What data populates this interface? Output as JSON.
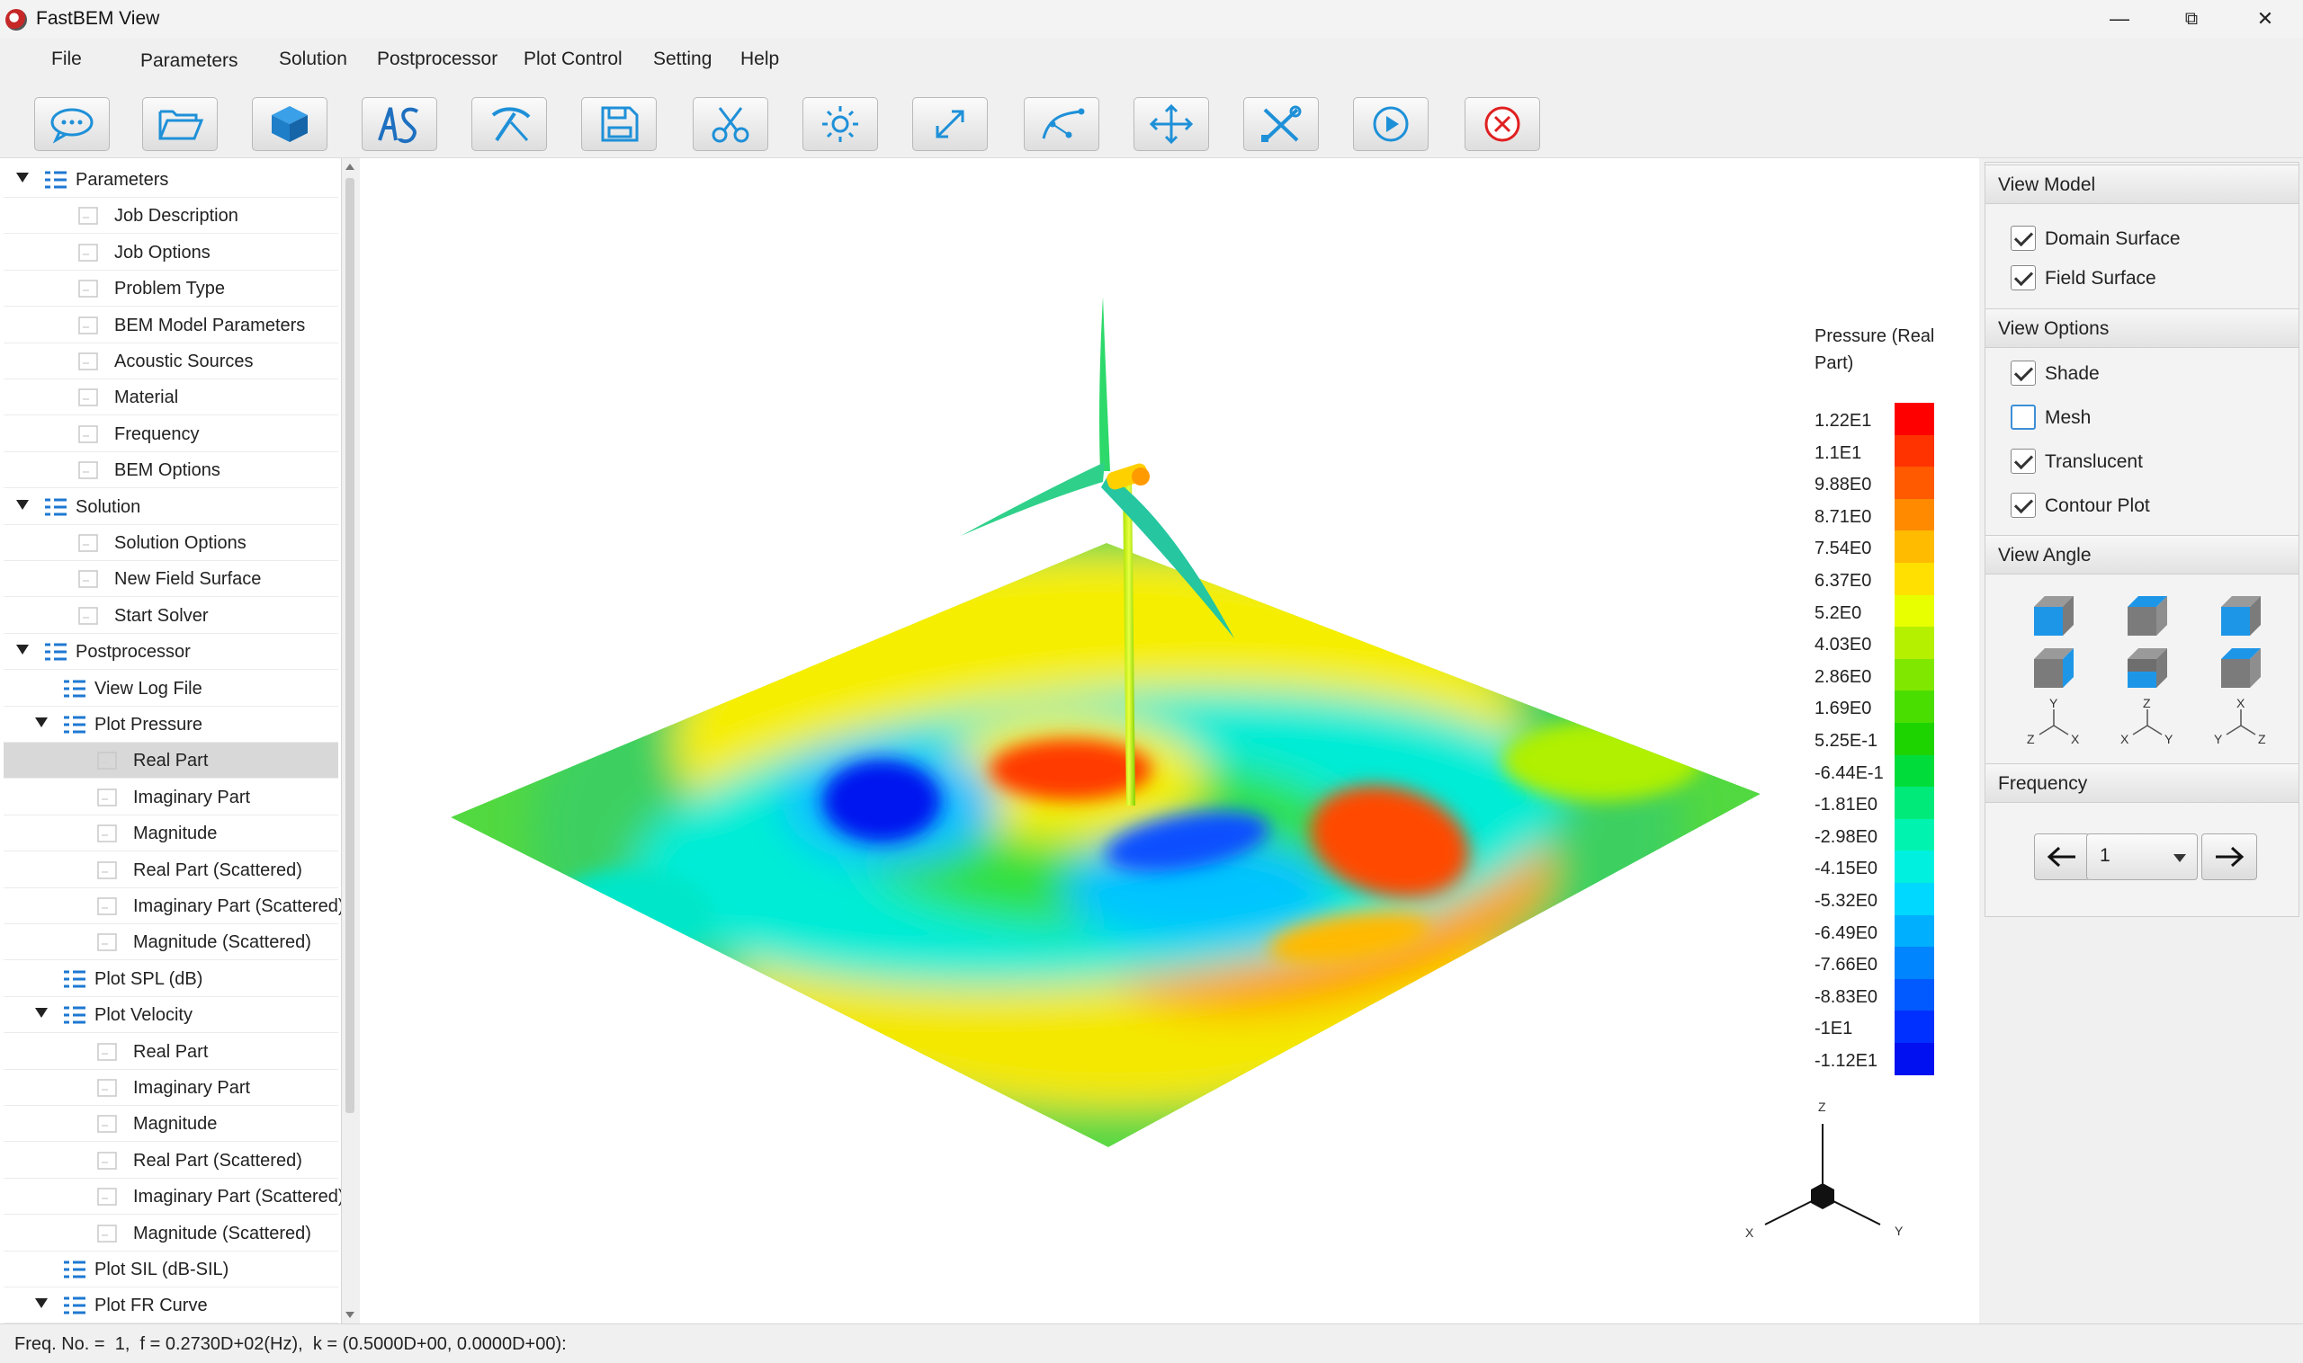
{
  "window": {
    "title": "FastBEM View",
    "minimize": "—",
    "restore": "⧉",
    "close": "✕"
  },
  "menu": [
    "File",
    "Parameters",
    "Solution",
    "Postprocessor",
    "Plot Control",
    "Setting",
    "Help"
  ],
  "toolbar": [
    "chat-icon",
    "folder-open-icon",
    "cube-icon",
    "as-logo-icon",
    "pickaxe-icon",
    "save-icon",
    "scissors-icon",
    "light-icon",
    "fit-view-icon",
    "vector-path-icon",
    "move-icon",
    "tools-icon",
    "play-icon",
    "stop-icon"
  ],
  "tree": [
    {
      "label": "Parameters",
      "level": 0,
      "kind": "group",
      "expanded": true
    },
    {
      "label": "Job Description",
      "level": 1,
      "kind": "doc"
    },
    {
      "label": "Job Options",
      "level": 1,
      "kind": "doc"
    },
    {
      "label": "Problem Type",
      "level": 1,
      "kind": "doc"
    },
    {
      "label": "BEM Model Parameters",
      "level": 1,
      "kind": "doc"
    },
    {
      "label": "Acoustic Sources",
      "level": 1,
      "kind": "doc"
    },
    {
      "label": "Material",
      "level": 1,
      "kind": "doc"
    },
    {
      "label": "Frequency",
      "level": 1,
      "kind": "doc"
    },
    {
      "label": "BEM Options",
      "level": 1,
      "kind": "doc"
    },
    {
      "label": "Solution",
      "level": 0,
      "kind": "group",
      "expanded": true
    },
    {
      "label": "Solution Options",
      "level": 1,
      "kind": "doc"
    },
    {
      "label": "New Field Surface",
      "level": 1,
      "kind": "doc"
    },
    {
      "label": "Start Solver",
      "level": 1,
      "kind": "doc"
    },
    {
      "label": "Postprocessor",
      "level": 0,
      "kind": "group",
      "expanded": true
    },
    {
      "label": "View Log File",
      "level": 1,
      "kind": "list"
    },
    {
      "label": "Plot Pressure",
      "level": 1,
      "kind": "group",
      "expanded": true
    },
    {
      "label": "Real Part",
      "level": 2,
      "kind": "doc",
      "selected": true
    },
    {
      "label": "Imaginary Part",
      "level": 2,
      "kind": "doc"
    },
    {
      "label": "Magnitude",
      "level": 2,
      "kind": "doc"
    },
    {
      "label": "Real Part (Scattered)",
      "level": 2,
      "kind": "doc"
    },
    {
      "label": "Imaginary Part (Scattered)",
      "level": 2,
      "kind": "doc"
    },
    {
      "label": "Magnitude (Scattered)",
      "level": 2,
      "kind": "doc"
    },
    {
      "label": "Plot SPL (dB)",
      "level": 1,
      "kind": "list"
    },
    {
      "label": "Plot Velocity",
      "level": 1,
      "kind": "group",
      "expanded": true
    },
    {
      "label": "Real Part",
      "level": 2,
      "kind": "doc"
    },
    {
      "label": "Imaginary Part",
      "level": 2,
      "kind": "doc"
    },
    {
      "label": "Magnitude",
      "level": 2,
      "kind": "doc"
    },
    {
      "label": "Real Part (Scattered)",
      "level": 2,
      "kind": "doc"
    },
    {
      "label": "Imaginary Part (Scattered)",
      "level": 2,
      "kind": "doc"
    },
    {
      "label": "Magnitude (Scattered)",
      "level": 2,
      "kind": "doc"
    },
    {
      "label": "Plot SIL (dB-SIL)",
      "level": 1,
      "kind": "list"
    },
    {
      "label": "Plot FR Curve",
      "level": 1,
      "kind": "group",
      "expanded": true
    }
  ],
  "colorbar": {
    "title": "Pressure (Real Part)",
    "labels": [
      "1.22E1",
      "1.1E1",
      "9.88E0",
      "8.71E0",
      "7.54E0",
      "6.37E0",
      "5.2E0",
      "4.03E0",
      "2.86E0",
      "1.69E0",
      "5.25E-1",
      "-6.44E-1",
      "-1.81E0",
      "-2.98E0",
      "-4.15E0",
      "-5.32E0",
      "-6.49E0",
      "-7.66E0",
      "-8.83E0",
      "-1E1",
      "-1.12E1"
    ],
    "colors": [
      "#ff0000",
      "#ff3300",
      "#ff5a00",
      "#ff8a00",
      "#ffbb00",
      "#ffe000",
      "#e8ff00",
      "#b4f000",
      "#80e800",
      "#4ade00",
      "#1ed400",
      "#00dd3a",
      "#00ea7a",
      "#00f4b0",
      "#00f0e0",
      "#00d8ff",
      "#00b0ff",
      "#0085ff",
      "#005aff",
      "#0030ff",
      "#0010f0"
    ]
  },
  "axes": {
    "z": "Z",
    "x": "X",
    "y": "Y"
  },
  "right_panel": {
    "view_model": {
      "title": "View Model",
      "items": [
        {
          "label": "Domain Surface",
          "checked": true
        },
        {
          "label": "Field Surface",
          "checked": true
        }
      ]
    },
    "view_options": {
      "title": "View Options",
      "items": [
        {
          "label": "Shade",
          "checked": true
        },
        {
          "label": "Mesh",
          "checked": false
        },
        {
          "label": "Translucent",
          "checked": true
        },
        {
          "label": "Contour Plot",
          "checked": true
        }
      ]
    },
    "view_angle": {
      "title": "View Angle",
      "triad_labels": [
        {
          "top": "Y",
          "left": "Z",
          "right": "X"
        },
        {
          "top": "Z",
          "left": "X",
          "right": "Y"
        },
        {
          "top": "X",
          "left": "Y",
          "right": "Z"
        }
      ]
    },
    "frequency": {
      "title": "Frequency",
      "value": "1",
      "prev": "←",
      "next": "→"
    }
  },
  "status": "Freq. No. =  1,  f = 0.2730D+02(Hz),  k = (0.5000D+00, 0.0000D+00):"
}
